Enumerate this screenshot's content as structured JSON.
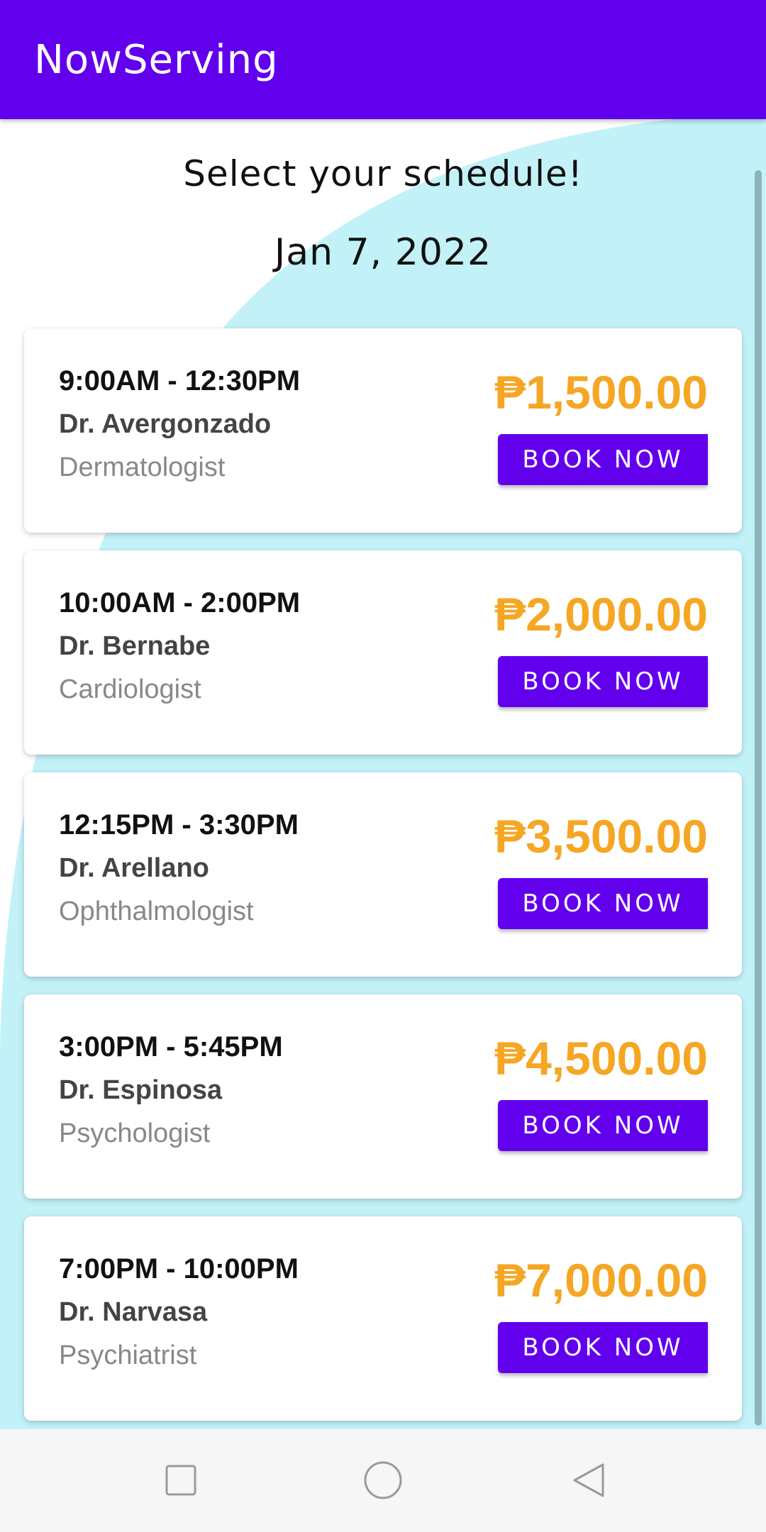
{
  "app": {
    "title": "NowServing"
  },
  "page": {
    "heading": "Select your schedule!",
    "date": "Jan 7, 2022"
  },
  "schedules": [
    {
      "time": "9:00AM - 12:30PM",
      "doctor": "Dr. Avergonzado",
      "specialty": "Dermatologist",
      "price": "₱1,500.00",
      "button": "BOOK NOW"
    },
    {
      "time": "10:00AM - 2:00PM",
      "doctor": "Dr. Bernabe",
      "specialty": "Cardiologist",
      "price": "₱2,000.00",
      "button": "BOOK NOW"
    },
    {
      "time": "12:15PM - 3:30PM",
      "doctor": "Dr. Arellano",
      "specialty": "Ophthalmologist",
      "price": "₱3,500.00",
      "button": "BOOK NOW"
    },
    {
      "time": "3:00PM - 5:45PM",
      "doctor": "Dr. Espinosa",
      "specialty": "Psychologist",
      "price": "₱4,500.00",
      "button": "BOOK NOW"
    },
    {
      "time": "7:00PM - 10:00PM",
      "doctor": "Dr. Narvasa",
      "specialty": "Psychiatrist",
      "price": "₱7,000.00",
      "button": "BOOK NOW"
    }
  ],
  "nav": {
    "recents_icon": "square-icon",
    "home_icon": "circle-icon",
    "back_icon": "triangle-back-icon"
  },
  "colors": {
    "primary": "#6200EE",
    "price": "#F5A623",
    "background_wave": "#C2F2F8"
  }
}
